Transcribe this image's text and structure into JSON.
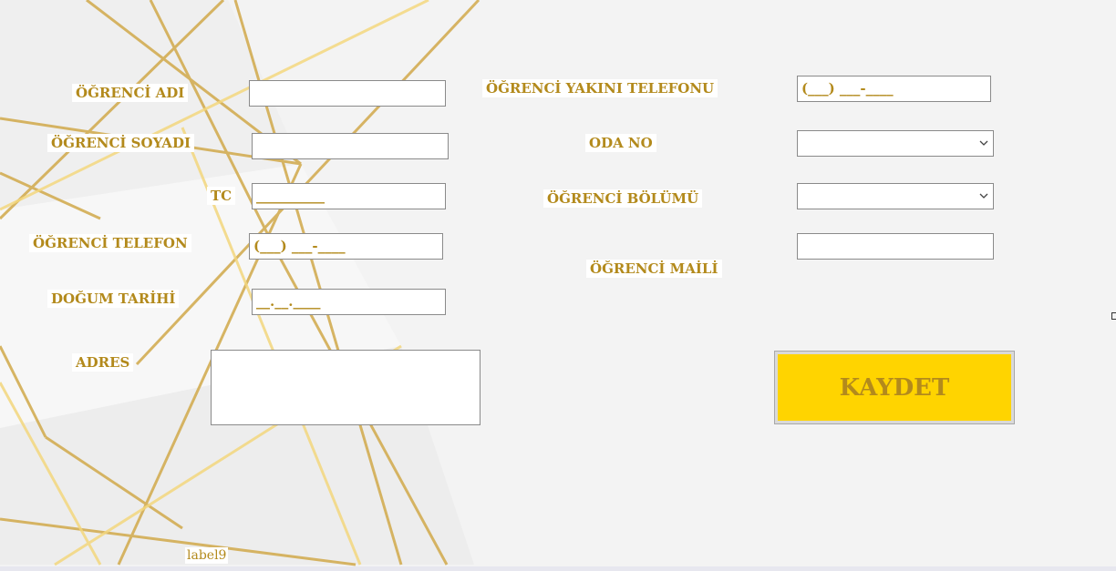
{
  "form": {
    "ogrenci_adi_label": "ÖĞRENCİ ADI",
    "ogrenci_soyadi_label": "ÖĞRENCİ SOYADI",
    "tc_label": "TC",
    "tc_mask": "__________",
    "ogrenci_telefon_label": "ÖĞRENCİ TELEFON",
    "ogrenci_telefon_mask": "(___) ___-____",
    "dogum_tarihi_label": "DOĞUM TARİHİ",
    "dogum_tarihi_mask": "__.__.____",
    "adres_label": "ADRES",
    "yakini_telefon_label": "ÖĞRENCİ YAKINI TELEFONU",
    "yakini_telefon_mask": "(___) ___-____",
    "oda_no_label": "ODA NO",
    "bolum_label": "ÖĞRENCİ BÖLÜMÜ",
    "mail_label": "ÖĞRENCİ MAİLİ",
    "kaydet_label": "KAYDET",
    "label9": "label9"
  },
  "colors": {
    "accent_gold": "#b38a1c",
    "button_yellow": "#ffd400",
    "background": "#f3f3f3"
  },
  "icons": {
    "dropdown": "chevron-down-icon"
  }
}
